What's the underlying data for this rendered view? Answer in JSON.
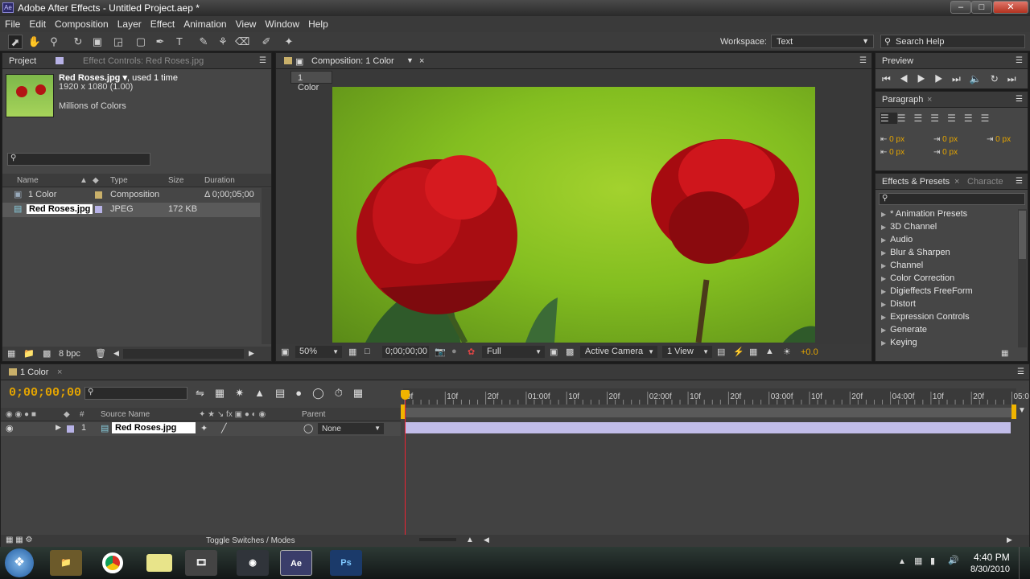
{
  "window": {
    "title": "Adobe After Effects - Untitled Project.aep *",
    "app_icon": "Ae",
    "controls": [
      "minimize",
      "maximize",
      "close"
    ]
  },
  "menu": [
    "File",
    "Edit",
    "Composition",
    "Layer",
    "Effect",
    "Animation",
    "View",
    "Window",
    "Help"
  ],
  "toolbar": {
    "workspace_label": "Workspace:",
    "workspace_value": "Text",
    "search_placeholder": "Search Help"
  },
  "project": {
    "tab_project": "Project",
    "tab_effect_controls": "Effect Controls: Red Roses.jpg",
    "preview": {
      "name": "Red Roses.jpg",
      "usage": ", used 1 time",
      "dims": "1920 x 1080 (1.00)",
      "color": "Millions of Colors"
    },
    "columns": {
      "name": "Name",
      "type": "Type",
      "size": "Size",
      "duration": "Duration"
    },
    "items": [
      {
        "name": "1 Color",
        "label_color": "#c9b06a",
        "type": "Composition",
        "size": "",
        "duration": "Δ 0;00;05;00"
      },
      {
        "name": "Red Roses.jpg",
        "label_color": "#b7b2e6",
        "type": "JPEG",
        "size": "172 KB",
        "duration": ""
      }
    ],
    "bpc": "8 bpc"
  },
  "composition": {
    "tab": "Composition: 1 Color",
    "subtab": "1 Color",
    "zoom": "50%",
    "timecode": "0;00;00;00",
    "resolution": "Full",
    "camera": "Active Camera",
    "views": "1 View",
    "exposure": "+0.0"
  },
  "preview_panel": {
    "title": "Preview"
  },
  "paragraph": {
    "title": "Paragraph",
    "indents": [
      "0 px",
      "0 px",
      "0 px",
      "0 px",
      "0 px"
    ]
  },
  "effects": {
    "tab": "Effects & Presets",
    "tab2": "Characte",
    "categories": [
      "* Animation Presets",
      "3D Channel",
      "Audio",
      "Blur & Sharpen",
      "Channel",
      "Color Correction",
      "Digieffects FreeForm",
      "Distort",
      "Expression Controls",
      "Generate",
      "Keying"
    ]
  },
  "timeline": {
    "tab": "1 Color",
    "timecode": "0;00;00;00",
    "columns": {
      "num": "#",
      "source": "Source Name",
      "parent": "Parent"
    },
    "layers": [
      {
        "num": "1",
        "name": "Red Roses.jpg",
        "parent": "None"
      }
    ],
    "ruler": [
      "0f",
      "10f",
      "20f",
      "01:00f",
      "10f",
      "20f",
      "02:00f",
      "10f",
      "20f",
      "03:00f",
      "10f",
      "20f",
      "04:00f",
      "10f",
      "20f",
      "05:0"
    ],
    "footer": "Toggle Switches / Modes"
  },
  "taskbar": {
    "apps": [
      "Explorer",
      "Chrome",
      "Sticky",
      "Film",
      "Media",
      "Ae",
      "Ps"
    ],
    "time": "4:40 PM",
    "date": "8/30/2010"
  },
  "colors": {
    "accent_yellow": "#f0b400",
    "timecode": "#e5a500",
    "layer_bar": "#c1bde9"
  }
}
